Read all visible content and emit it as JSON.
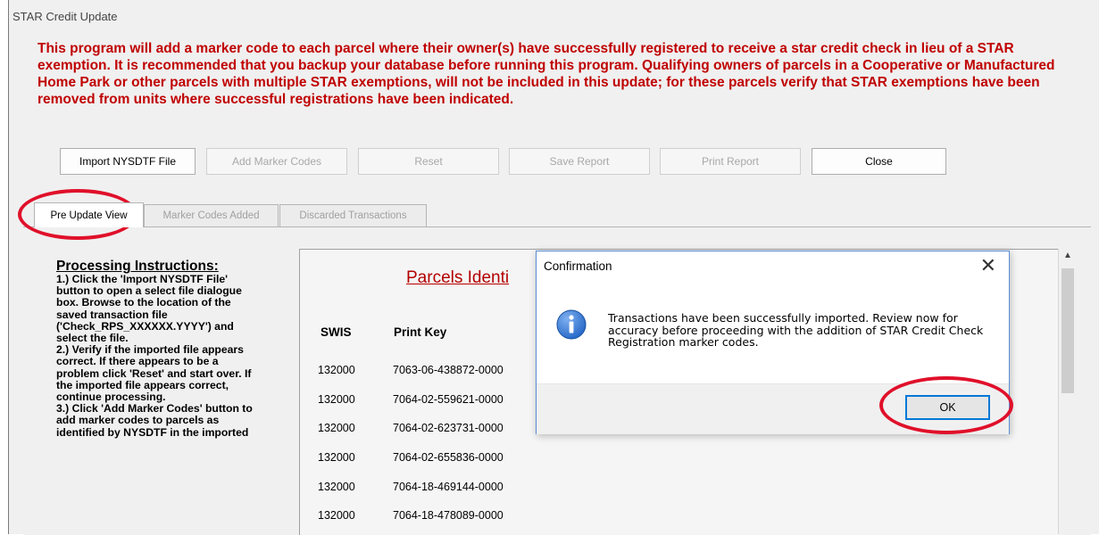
{
  "window": {
    "title": "STAR Credit Update"
  },
  "intro": {
    "text": "This program will add a marker code to each parcel where their owner(s) have successfully registered to receive a star credit check in lieu of a STAR exemption.  It is recommended that you backup your database before running this program.  Qualifying owners of parcels in a Cooperative or Manufactured Home Park or other parcels with multiple STAR exemptions, will not be included in this update; for these parcels verify that STAR exemptions have been removed from units where successful registrations have been indicated."
  },
  "toolbar": {
    "import_label": "Import NYSDTF File",
    "add_marker_label": "Add Marker Codes",
    "reset_label": "Reset",
    "save_report_label": "Save Report",
    "print_report_label": "Print Report",
    "close_label": "Close"
  },
  "tabs": [
    {
      "label": "Pre Update View"
    },
    {
      "label": "Marker Codes Added"
    },
    {
      "label": "Discarded Transactions"
    }
  ],
  "instructions": {
    "heading": "Processing Instructions:",
    "body": "1.) Click the 'Import NYSDTF File' button to open a select file dialogue box.  Browse to the location of the saved transaction file ('Check_RPS_XXXXXX.YYYY') and select the file.\n2.) Verify if the imported file appears correct.  If there appears to be a problem click 'Reset' and start over.  If the imported file appears correct, continue processing.\n3.) Click 'Add Marker Codes' button to add marker codes to parcels as identified by NYSDTF in the imported"
  },
  "grid": {
    "title": "Parcels Identi",
    "columns": [
      "SWIS",
      "Print Key"
    ],
    "rows": [
      [
        "132000",
        "7063-06-438872-0000"
      ],
      [
        "132000",
        "7064-02-559621-0000"
      ],
      [
        "132000",
        "7064-02-623731-0000"
      ],
      [
        "132000",
        "7064-02-655836-0000"
      ],
      [
        "132000",
        "7064-18-469144-0000"
      ],
      [
        "132000",
        "7064-18-478089-0000"
      ]
    ]
  },
  "dialog": {
    "title": "Confirmation",
    "close_glyph": "✕",
    "message": "Transactions have been successfully imported.  Review now for accuracy before proceeding with the addition of STAR Credit Check Registration marker codes.",
    "icon": "info-icon",
    "ok_label": "OK"
  },
  "colors": {
    "intro_text": "#c00000",
    "grid_title": "#b40000",
    "annotation": "#e0102a",
    "info_icon": "#1e62c4",
    "focus_border": "#0078d7"
  }
}
